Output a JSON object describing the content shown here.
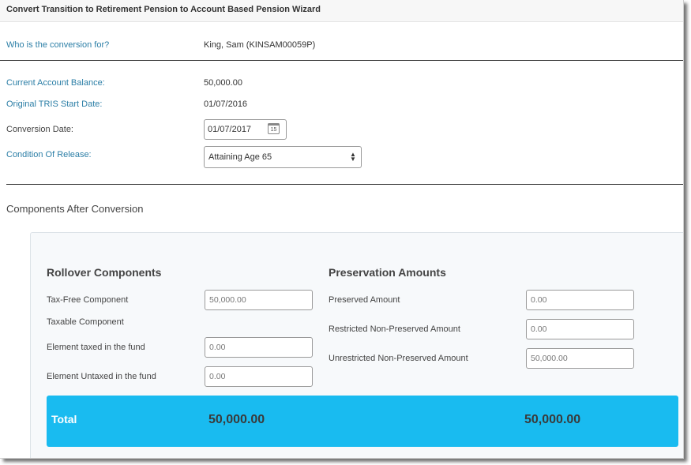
{
  "window": {
    "title": "Convert Transition to Retirement Pension to Account Based Pension Wizard"
  },
  "form": {
    "who_label": "Who is the conversion for?",
    "who_value": "King, Sam (KINSAM00059P)",
    "balance_label": "Current Account Balance:",
    "balance_value": "50,000.00",
    "tris_start_label": "Original TRIS Start Date:",
    "tris_start_value": "01/07/2016",
    "conversion_date_label": "Conversion Date:",
    "conversion_date_value": "01/07/2017",
    "calendar_icon_text": "15",
    "condition_label": "Condition Of Release:",
    "condition_value": "Attaining Age 65"
  },
  "components": {
    "heading": "Components After Conversion",
    "rollover": {
      "title": "Rollover Components",
      "tax_free_label": "Tax-Free Component",
      "tax_free_value": "50,000.00",
      "taxable_label": "Taxable Component",
      "taxed_label": "Element taxed in the fund",
      "taxed_value": "0.00",
      "untaxed_label": "Element Untaxed in the fund",
      "untaxed_value": "0.00"
    },
    "preservation": {
      "title": "Preservation Amounts",
      "preserved_label": "Preserved Amount",
      "preserved_value": "0.00",
      "restricted_label": "Restricted Non-Preserved Amount",
      "restricted_value": "0.00",
      "unrestricted_label": "Unrestricted Non-Preserved Amount",
      "unrestricted_value": "50,000.00"
    },
    "total": {
      "label": "Total",
      "rollover_total": "50,000.00",
      "preservation_total": "50,000.00"
    }
  },
  "colors": {
    "label_blue": "#2b7ea6",
    "total_bar": "#19bbf0"
  }
}
